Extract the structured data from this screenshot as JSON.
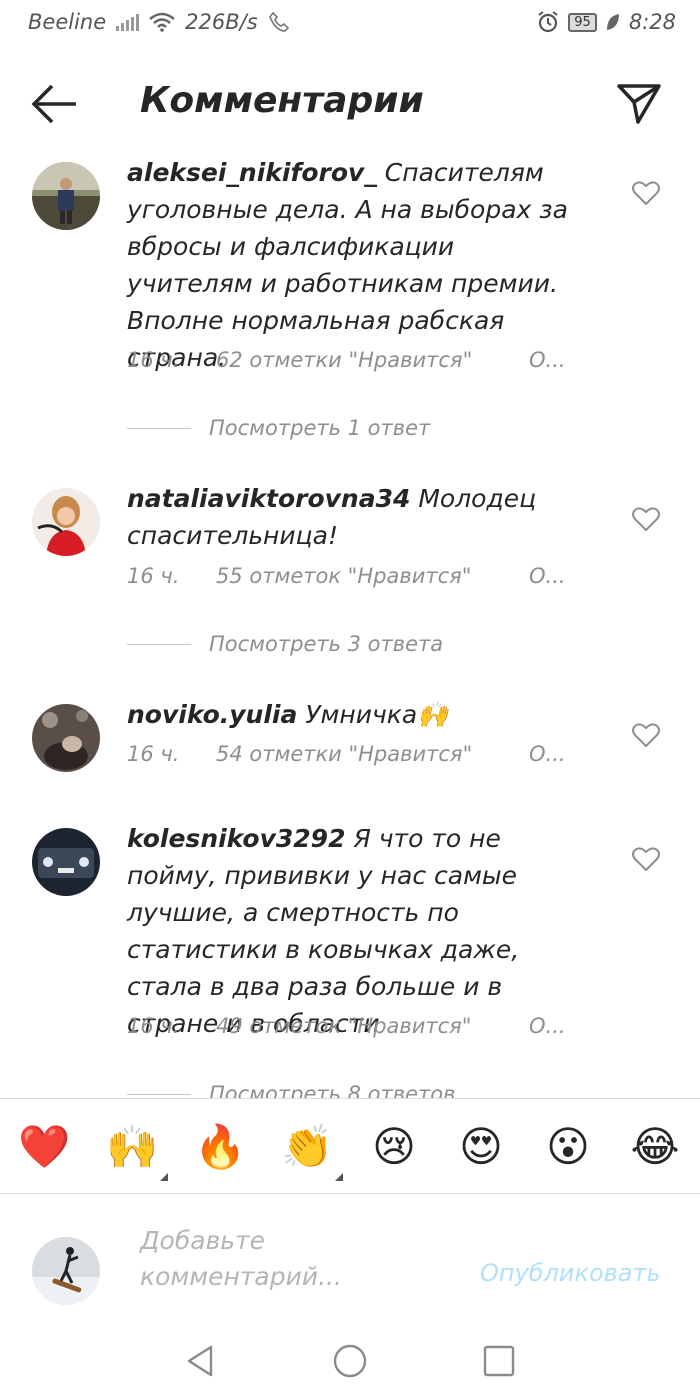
{
  "status_bar": {
    "carrier": "Beeline",
    "speed": "226B/s",
    "battery": "95",
    "time": "8:28"
  },
  "header": {
    "title": "Комментарии"
  },
  "comments": [
    {
      "username": "aleksei_nikiforov_",
      "text": "Спасителям уголовные дела. А на выборах за вбросы и фалсификации учителям и работникам премии. Вполне нормальная рабская страна.",
      "time": "16 ч.",
      "likes": "62 отметки \"Нравится\"",
      "reply": "О...",
      "view_replies": "Посмотреть 1 ответ"
    },
    {
      "username": "nataliaviktorovna34",
      "text": "Молодец спасительница!",
      "time": "16 ч.",
      "likes": "55 отметок \"Нравится\"",
      "reply": "О...",
      "view_replies": "Посмотреть 3 ответа"
    },
    {
      "username": "noviko.yulia",
      "text": "Умничка🙌",
      "time": "16 ч.",
      "likes": "54 отметки \"Нравится\"",
      "reply": "О..."
    },
    {
      "username": "kolesnikov3292",
      "text": "Я что то не пойму, прививки у нас самые лучшие, а смертность по статистики в ковычках даже, стала в два раза больше и в стране и в области",
      "time": "16 ч.",
      "likes": "49 отметок \"Нравится\"",
      "reply": "О...",
      "view_replies": "Посмотреть 8 ответов"
    }
  ],
  "emoji_bar": [
    "❤️",
    "🙌",
    "🔥",
    "👏",
    "😢",
    "😍",
    "😮",
    "😂"
  ],
  "compose": {
    "placeholder": "Добавьте комментарий...",
    "publish_label": "Опубликовать"
  }
}
